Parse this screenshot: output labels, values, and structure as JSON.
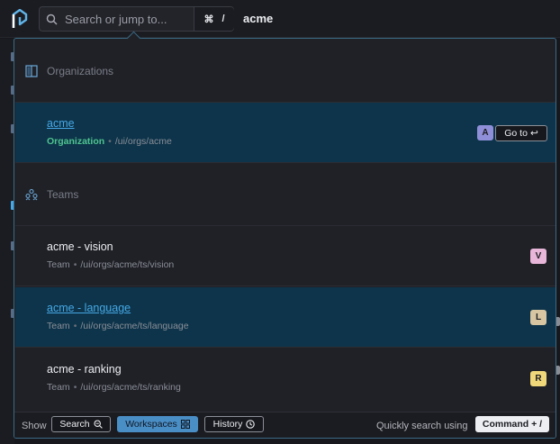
{
  "topbar": {
    "search": {
      "placeholder": "Search or jump to...",
      "value": ""
    },
    "shortcut": {
      "modifier_glyph": "⌘",
      "slash_glyph": "/"
    },
    "breadcrumb": "acme"
  },
  "results": {
    "groups": [
      {
        "title": "Organizations",
        "icon": "organization-icon"
      },
      {
        "title": "Teams",
        "icon": "teams-icon"
      }
    ],
    "org_item": {
      "title": "acme",
      "kind": "Organization",
      "path": "/ui/orgs/acme",
      "badge": "A",
      "badge_color": "#8f8fd9",
      "goto_label": "Go to",
      "goto_glyph": "↩"
    },
    "team_items": [
      {
        "title": "acme - vision",
        "kind": "Team",
        "path": "/ui/orgs/acme/ts/vision",
        "badge": "V",
        "badge_color": "#e7b6d8",
        "selected": false
      },
      {
        "title": "acme - language",
        "kind": "Team",
        "path": "/ui/orgs/acme/ts/language",
        "badge": "L",
        "badge_color": "#d8c6a2",
        "selected": true
      },
      {
        "title": "acme - ranking",
        "kind": "Team",
        "path": "/ui/orgs/acme/ts/ranking",
        "badge": "R",
        "badge_color": "#f0d77a",
        "selected": false
      }
    ],
    "separator": "•"
  },
  "footer": {
    "show_label": "Show",
    "buttons": [
      {
        "label": "Search",
        "icon": "zoom-search-icon",
        "active": false
      },
      {
        "label": "Workspaces",
        "icon": "grid-icon",
        "active": true
      },
      {
        "label": "History",
        "icon": "history-clock-icon",
        "active": false
      }
    ],
    "quick_label": "Quickly search using",
    "command_label": "Command + /"
  },
  "colors": {
    "accent": "#46a8e6",
    "selected_row": "#0d344a",
    "org_kind": "#4fc48f",
    "active_button": "#4a8ec6"
  }
}
